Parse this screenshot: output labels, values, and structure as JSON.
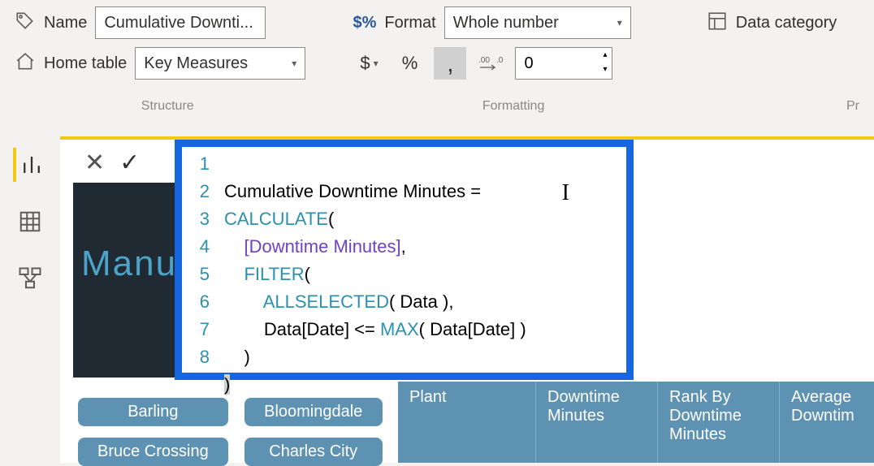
{
  "ribbon": {
    "name_label": "Name",
    "name_value": "Cumulative Downti...",
    "home_label": "Home table",
    "home_value": "Key Measures",
    "format_label": "Format",
    "format_value": "Whole number",
    "decimal_value": "0",
    "structure_caption": "Structure",
    "formatting_caption": "Formatting",
    "props_caption": "Pr",
    "data_category_label": "Data category",
    "currency_symbol": "$",
    "percent_symbol": "%",
    "comma_symbol": ",",
    "decimals_icon": ".00→.0",
    "format_icon_label": "$%"
  },
  "dax": {
    "line_nums": [
      "1",
      "2",
      "3",
      "4",
      "5",
      "6",
      "7",
      "8"
    ],
    "line1_plain": "Cumulative Downtime Minutes =",
    "line2_kw": "CALCULATE",
    "line2_rest": "(",
    "line3_pre": "    ",
    "line3_mea": "[Downtime Minutes]",
    "line3_rest": ",",
    "line4_pre": "    ",
    "line4_kw": "FILTER",
    "line4_rest": "(",
    "line5_pre": "        ",
    "line5_kw": "ALLSELECTED",
    "line5_rest": "( Data ),",
    "line6_pre": "        Data[Date] <= ",
    "line6_kw": "MAX",
    "line6_rest": "( Data[Date] )",
    "line7": "    )",
    "line8": ")"
  },
  "report": {
    "title_partial": "Manu"
  },
  "slicer": {
    "b1": "Barling",
    "b2": "Bloomingdale",
    "b3": "Bruce Crossing",
    "b4": "Charles City"
  },
  "table": {
    "c1": "Plant",
    "c2": "Downtime Minutes",
    "c3": "Rank By Downtime Minutes",
    "c4": "Average Downtim"
  }
}
